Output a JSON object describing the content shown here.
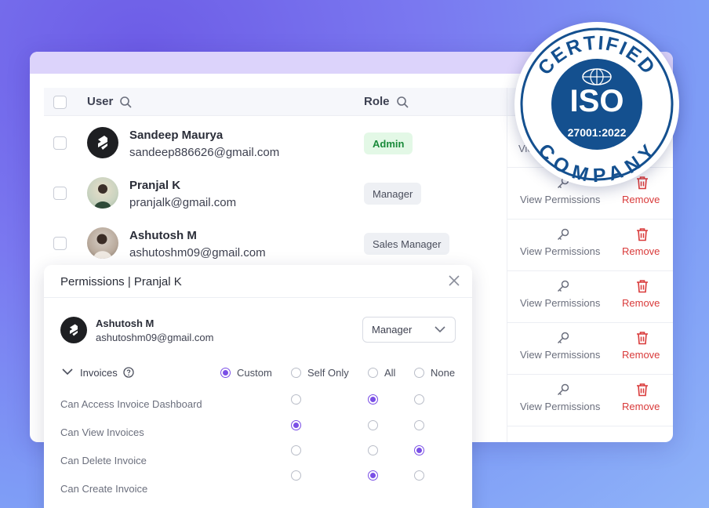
{
  "table": {
    "headers": {
      "user": "User",
      "role": "Role"
    },
    "rows": [
      {
        "name": "Sandeep Maurya",
        "email": "sandeep886626@gmail.com",
        "role": "Admin"
      },
      {
        "name": "Pranjal K",
        "email": "pranjalk@gmail.com",
        "role": "Manager"
      },
      {
        "name": "Ashutosh M",
        "email": "ashutoshm09@gmail.com",
        "role": "Sales Manager"
      }
    ],
    "actions": {
      "view_partial": "View",
      "view_permissions": "View Permissions",
      "remove": "Remove"
    }
  },
  "modal": {
    "title": "Permissions | Pranjal K",
    "user_name": "Ashutosh M",
    "user_email": "ashutoshm09@gmail.com",
    "role_select": "Manager",
    "section": "Invoices",
    "scope_options": [
      "Custom",
      "Self Only",
      "All",
      "None"
    ],
    "selected_scope": "Custom",
    "permissions": [
      {
        "label": "Can Access Invoice Dashboard",
        "selected": "All"
      },
      {
        "label": "Can View Invoices",
        "selected": "Custom"
      },
      {
        "label": "Can Delete Invoice",
        "selected": "None"
      },
      {
        "label": "Can Create Invoice",
        "selected": "All"
      }
    ]
  },
  "badge": {
    "top_text": "CERTIFIED",
    "center_text": "ISO",
    "standard": "27001:2022",
    "bottom_text": "COMPANY"
  },
  "colors": {
    "accent": "#7a4fe6",
    "remove": "#d93a3a",
    "admin_bg": "#e3f8e6",
    "admin_text": "#1a8a3a",
    "badge_blue": "#14508f"
  },
  "icons": [
    "search-icon",
    "key-icon",
    "trash-icon",
    "close-icon",
    "chevron-down-icon",
    "help-circle-icon"
  ]
}
